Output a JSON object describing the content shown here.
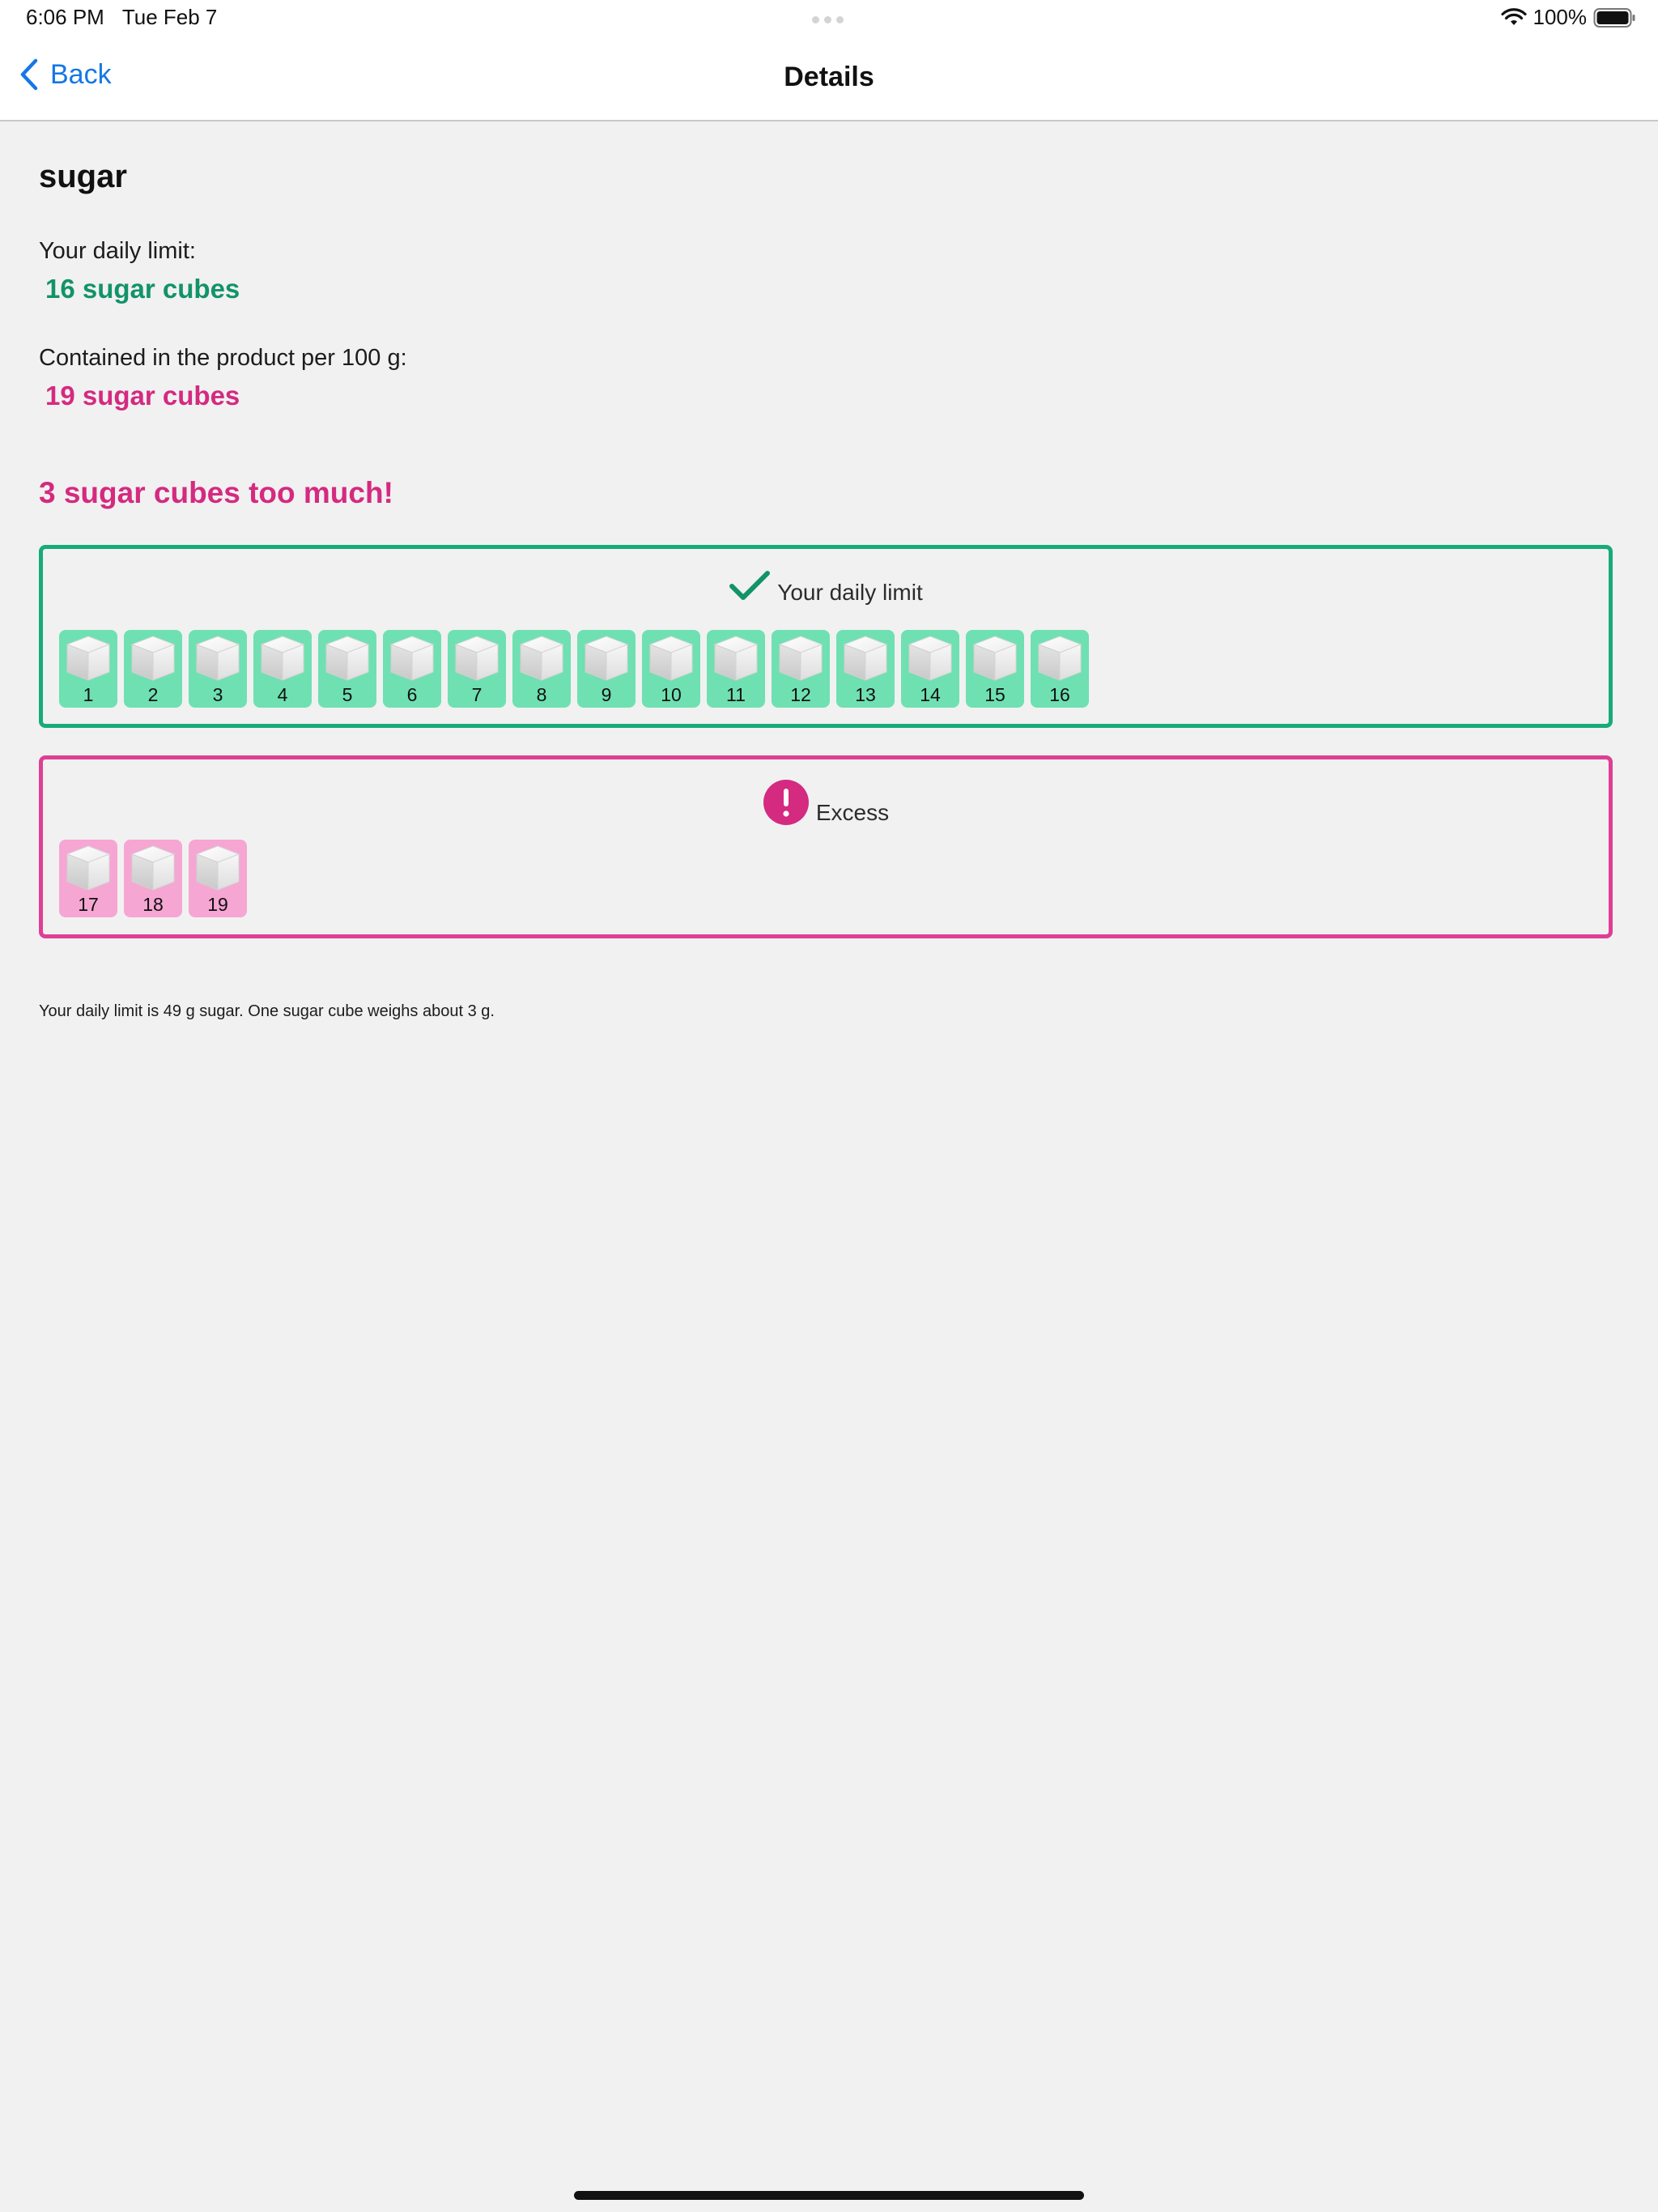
{
  "status_bar": {
    "time": "6:06 PM",
    "date": "Tue Feb 7",
    "battery": "100%",
    "icons": [
      "wifi-icon",
      "battery-icon"
    ]
  },
  "nav": {
    "back_label": "Back",
    "title": "Details",
    "icons": [
      "chevron-left-icon"
    ]
  },
  "detail": {
    "nutrient": "sugar",
    "limit_label": "Your daily limit:",
    "limit_value": "16 sugar cubes",
    "contained_label": "Contained in the product per 100 g:",
    "contained_value": "19 sugar cubes",
    "excess_headline": "3 sugar cubes too much!",
    "footnote": "Your daily limit is 49 g sugar. One sugar cube weighs about 3 g."
  },
  "limit_panel": {
    "heading": "Your daily limit",
    "icon": "checkmark-icon",
    "cubes": [
      "1",
      "2",
      "3",
      "4",
      "5",
      "6",
      "7",
      "8",
      "9",
      "10",
      "11",
      "12",
      "13",
      "14",
      "15",
      "16"
    ]
  },
  "excess_panel": {
    "heading": "Excess",
    "icon": "exclamation-icon",
    "cubes": [
      "17",
      "18",
      "19"
    ]
  },
  "colors": {
    "accent_blue": "#1577e6",
    "limit_green": "#12936a",
    "limit_border": "#17ab7a",
    "limit_tile": "#6fe0b2",
    "excess_pink": "#d42a80",
    "excess_border": "#de3f94",
    "excess_tile": "#f6a6d3",
    "background": "#f1f1f1"
  }
}
